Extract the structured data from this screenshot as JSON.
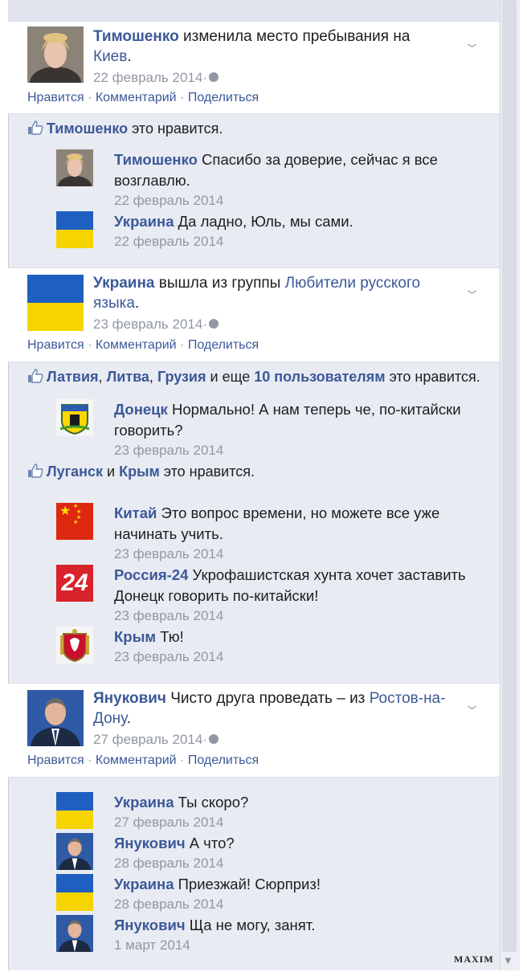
{
  "posts": [
    {
      "author": "Тимошенко",
      "text": " изменила место пребывания на ",
      "link": "Киев",
      "tail": ".",
      "date": "22 февраль 2014",
      "actions": [
        "Нравится",
        "Комментарий",
        "Поделиться"
      ]
    },
    {
      "author": "Украина",
      "text": " вышла из группы ",
      "link": "Любители русского языка",
      "tail": ".",
      "date": "23 февраль 2014",
      "actions": [
        "Нравится",
        "Комментарий",
        "Поделиться"
      ]
    },
    {
      "author": "Янукович",
      "text": " Чисто друга проведать – из ",
      "link": "Ростов-на-Дону",
      "tail": ".",
      "date": "27 февраль 2014",
      "actions": [
        "Нравится",
        "Комментарий",
        "Поделиться"
      ]
    }
  ],
  "likes": {
    "l1": {
      "names": [
        "Тимошенко"
      ],
      "suffix": " это нравится."
    },
    "l2": {
      "n1": "Латвия",
      "n2": "Литва",
      "n3": "Грузия",
      "mid": " и еще ",
      "more": "10 пользователям",
      "suffix": " это нравится."
    },
    "l3": {
      "n1": "Луганск",
      "mid": " и ",
      "n2": "Крым",
      "suffix": " это нравится."
    }
  },
  "comments": {
    "c1": {
      "author": "Тимошенко",
      "text": " Спасибо за доверие, сейчас я все возглавлю.",
      "date": "22 февраль 2014"
    },
    "c2": {
      "author": "Украина",
      "text": " Да ладно, Юль, мы сами.",
      "date": "22 февраль 2014"
    },
    "c3": {
      "author": "Донецк",
      "text": " Нормально! А нам теперь че, по-китайски говорить?",
      "date": "23 февраль 2014"
    },
    "c4": {
      "author": "Китай",
      "text": " Это вопрос времени, но можете все уже начинать учить.",
      "date": "23 февраль 2014"
    },
    "c5": {
      "author": "Россия-24",
      "text": " Укрофашистская хунта хочет заставить Донецк говорить по-китайски!",
      "date": "23 февраль 2014"
    },
    "c6": {
      "author": "Крым",
      "text": " Тю!",
      "date": "23 февраль 2014"
    },
    "c7": {
      "author": "Украина",
      "text": " Ты скоро?",
      "date": "27 февраль 2014"
    },
    "c8": {
      "author": "Янукович",
      "text": " А что?",
      "date": "28 февраль 2014"
    },
    "c9": {
      "author": "Украина",
      "text": " Приезжай! Сюрприз!",
      "date": "28 февраль 2014"
    },
    "c10": {
      "author": "Янукович",
      "text": " Ща не могу, занят.",
      "date": "1 март 2014"
    }
  },
  "badges": {
    "r24": "24"
  },
  "watermark": "MAXIM",
  "icons": {
    "privacy": "globe-icon",
    "like": "thumbs-up-icon",
    "menu": "chevron-down-icon",
    "scroll": "scroll-down-arrow-icon"
  },
  "colors": {
    "link": "#3b5998",
    "date": "#9197a3",
    "feed_bg": "#e9ebf3",
    "ukraine_blue": "#1f5fbf",
    "ukraine_yellow": "#f5d400"
  }
}
